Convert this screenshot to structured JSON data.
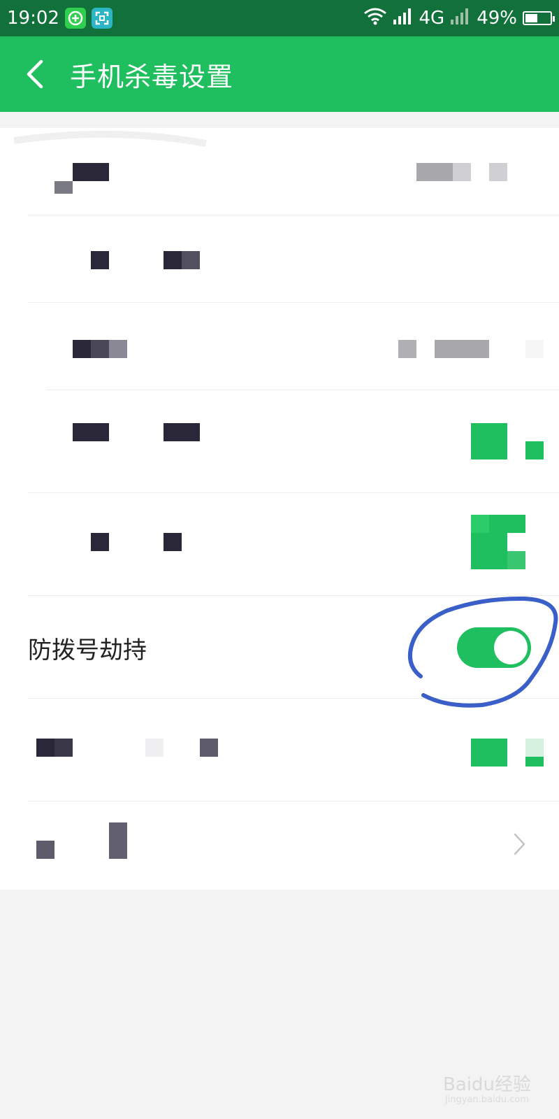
{
  "status_bar": {
    "time": "19:02",
    "icons": [
      "app-green-icon",
      "screenshot-icon"
    ],
    "network": "4G",
    "battery": "49%",
    "battery_level": 0.49
  },
  "app_bar": {
    "title": "手机杀毒设置",
    "back_icon": "back-arrow-icon"
  },
  "settings": {
    "highlighted_row": {
      "label": "防拨号劫持",
      "toggle_on": true
    }
  },
  "colors": {
    "status_bar": "#12703b",
    "app_bar": "#1fbe5e",
    "accent": "#1fbe5e",
    "annotation": "#3a5fc8"
  },
  "watermark": {
    "brand": "Baidu经验",
    "url": "jingyan.baidu.com"
  }
}
